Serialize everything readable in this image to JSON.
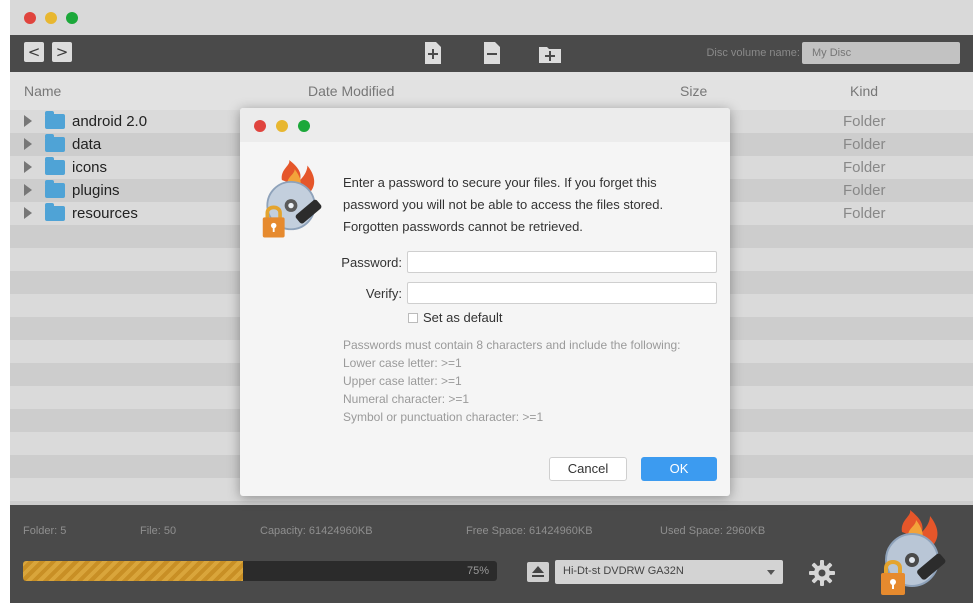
{
  "toolbar": {
    "back_icon": "chevron-left-icon",
    "forward_icon": "chevron-right-icon",
    "back_glyph": "<",
    "forward_glyph": ">",
    "add_icon": "add-file-icon",
    "remove_icon": "remove-file-icon",
    "new_folder_icon": "new-folder-icon",
    "disc_volume_label": "Disc volume name:",
    "disc_volume_placeholder": "My Disc"
  },
  "columns": {
    "name": "Name",
    "date_modified": "Date Modified",
    "size": "Size",
    "kind": "Kind"
  },
  "files": [
    {
      "name": "android 2.0",
      "kind": "Folder"
    },
    {
      "name": "data",
      "kind": "Folder"
    },
    {
      "name": "icons",
      "kind": "Folder"
    },
    {
      "name": "plugins",
      "kind": "Folder"
    },
    {
      "name": "resources",
      "kind": "Folder"
    }
  ],
  "dialog": {
    "message": "Enter a password to secure your files. If you forget this password you will not be able to access the files stored. Forgotten passwords cannot be retrieved.",
    "password_label": "Password:",
    "verify_label": "Verify:",
    "set_default_label": "Set as default",
    "rules": {
      "intro": "Passwords must contain 8 characters and include the following:",
      "lower": "Lower case letter: >=1",
      "upper": "Upper case latter: >=1",
      "numeral": "Numeral character: >=1",
      "symbol": "Symbol or punctuation character: >=1"
    },
    "cancel_label": "Cancel",
    "ok_label": "OK"
  },
  "status": {
    "folder": "Folder: 5",
    "file": "File: 50",
    "capacity": "Capacity: 61424960KB",
    "free_space": "Free Space: 61424960KB",
    "used_space": "Used Space: 2960KB",
    "progress_percent": 75,
    "progress_text": "75%",
    "drive": "Hi-Dt-st DVDRW GA32N"
  },
  "colors": {
    "accent_blue": "#3c9bf0",
    "folder_blue": "#4fa3d6",
    "progress_gold": "#d9a53b"
  }
}
